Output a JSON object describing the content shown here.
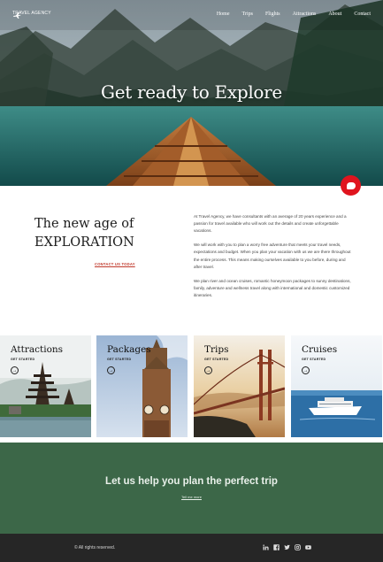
{
  "nav": {
    "logo_text": "TRAVEL AGENCY",
    "links": [
      "Home",
      "Trips",
      "Flights",
      "Attractions",
      "About",
      "Contact"
    ]
  },
  "hero": {
    "title": "Get ready to Explore"
  },
  "intro": {
    "heading_line1": "The new age of",
    "heading_line2": "EXPLORATION",
    "contact_label": "CONTACT US TODAY",
    "paragraphs": [
      "At Travel Agency, we have consultants with an average of 20 years experience and a passion for travel available who will work out the details and create unforgettable vacations.",
      "We will work with you to plan a worry free adventure that meets your travel needs, expectations and budget. When you plan your vacation with us we are there throughout the entire process.  This means making ourselves available to you before, during and after travel.",
      "We plan river and ocean cruises, romantic honeymoon packages to sunny destinations, family, adventure and wellness travel along with international and domestic customized itineraries."
    ]
  },
  "cards": [
    {
      "title": "Attractions",
      "cta": "GET STARTED"
    },
    {
      "title": "Packages",
      "cta": "GET STARTED"
    },
    {
      "title": "Trips",
      "cta": "GET STARTED"
    },
    {
      "title": "Cruises",
      "cta": "GET STARTED"
    }
  ],
  "cta": {
    "title": "Let us help you plan the perfect trip",
    "link": "Tell me more"
  },
  "footer": {
    "copyright": "© All rights reserved.",
    "social_icons": [
      "linkedin-icon",
      "facebook-icon",
      "twitter-icon",
      "instagram-icon",
      "youtube-icon"
    ]
  },
  "colors": {
    "accent_red": "#e0141e",
    "cta_green": "#3c6748",
    "footer_bg": "#262626"
  }
}
